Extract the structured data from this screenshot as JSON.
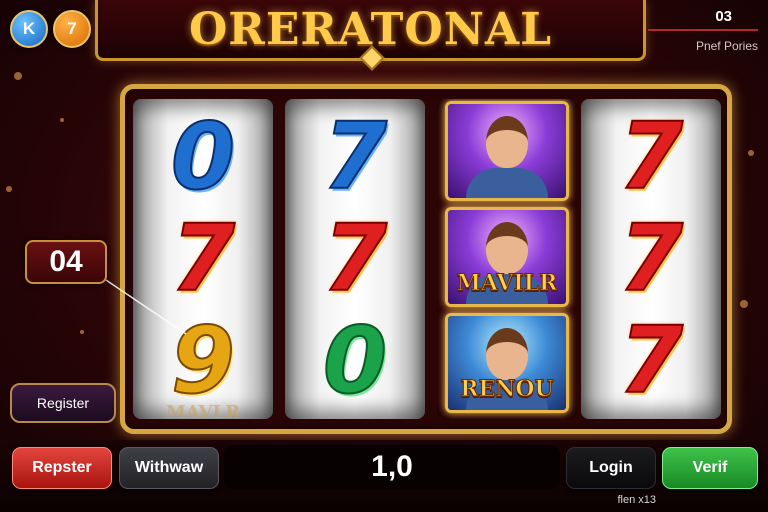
{
  "badges": [
    {
      "label": "K",
      "color": "#1565c0"
    },
    {
      "label": "7",
      "color": "#d86a00"
    }
  ],
  "title": "ORERATONAL",
  "counter": {
    "value": "03",
    "label": "Pnef Pories"
  },
  "reels": [
    {
      "symbols": [
        {
          "glyph": "0",
          "color": "blue"
        },
        {
          "glyph": "7",
          "color": "red"
        },
        {
          "glyph": "9",
          "color": "gold"
        }
      ],
      "partial_bottom": "MAVLR"
    },
    {
      "symbols": [
        {
          "glyph": "7",
          "color": "blue"
        },
        {
          "glyph": "7",
          "color": "red"
        },
        {
          "glyph": "0",
          "color": "green"
        }
      ]
    },
    {
      "cards": [
        {
          "name": ""
        },
        {
          "name": "MAVILR"
        },
        {
          "name": "RENOU"
        }
      ]
    },
    {
      "symbols": [
        {
          "glyph": "7",
          "color": "red"
        },
        {
          "glyph": "7",
          "color": "red"
        },
        {
          "glyph": "7",
          "color": "red"
        }
      ]
    }
  ],
  "callout": "04",
  "side_button": "Register",
  "buttons": {
    "repster": "Repster",
    "withdraw": "Withwaw",
    "login": "Login",
    "verif": "Verif"
  },
  "amount": "1,0",
  "footer": "flen x13",
  "colors": {
    "frame": "#d6a640",
    "background": "#2a0507",
    "title": "#ffc94a"
  }
}
